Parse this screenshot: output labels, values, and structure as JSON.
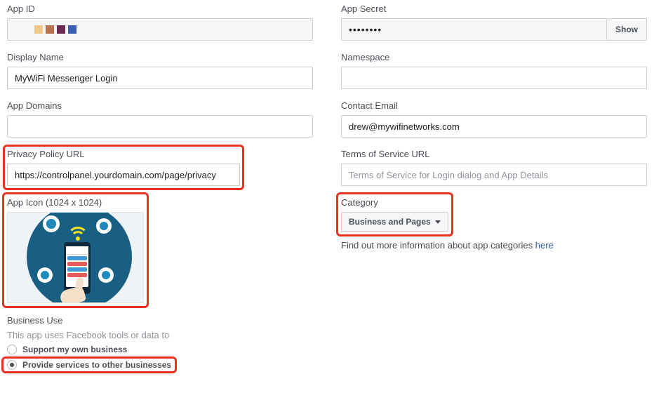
{
  "app_id": {
    "label": "App ID",
    "block_colors": [
      "#efc88a",
      "#b8724f",
      "#6e2a52",
      "#3a5fb2"
    ]
  },
  "app_secret": {
    "label": "App Secret",
    "masked": "••••••••",
    "show_btn": "Show"
  },
  "display_name": {
    "label": "Display Name",
    "value": "MyWiFi Messenger Login"
  },
  "namespace": {
    "label": "Namespace",
    "value": ""
  },
  "app_domains": {
    "label": "App Domains",
    "value": ""
  },
  "contact_email": {
    "label": "Contact Email",
    "value": "drew@mywifinetworks.com"
  },
  "privacy_url": {
    "label": "Privacy Policy URL",
    "value": "https://controlpanel.yourdomain.com/page/privacy"
  },
  "tos_url": {
    "label": "Terms of Service URL",
    "placeholder": "Terms of Service for Login dialog and App Details",
    "value": ""
  },
  "app_icon": {
    "label": "App Icon (1024 x 1024)"
  },
  "category": {
    "label": "Category",
    "selected": "Business and Pages",
    "info_prefix": "Find out more information about app categories ",
    "info_link": "here"
  },
  "business_use": {
    "label": "Business Use",
    "sub": "This app uses Facebook tools or data to",
    "option_own": "Support my own business",
    "option_services": "Provide services to other businesses",
    "selected": "services"
  }
}
